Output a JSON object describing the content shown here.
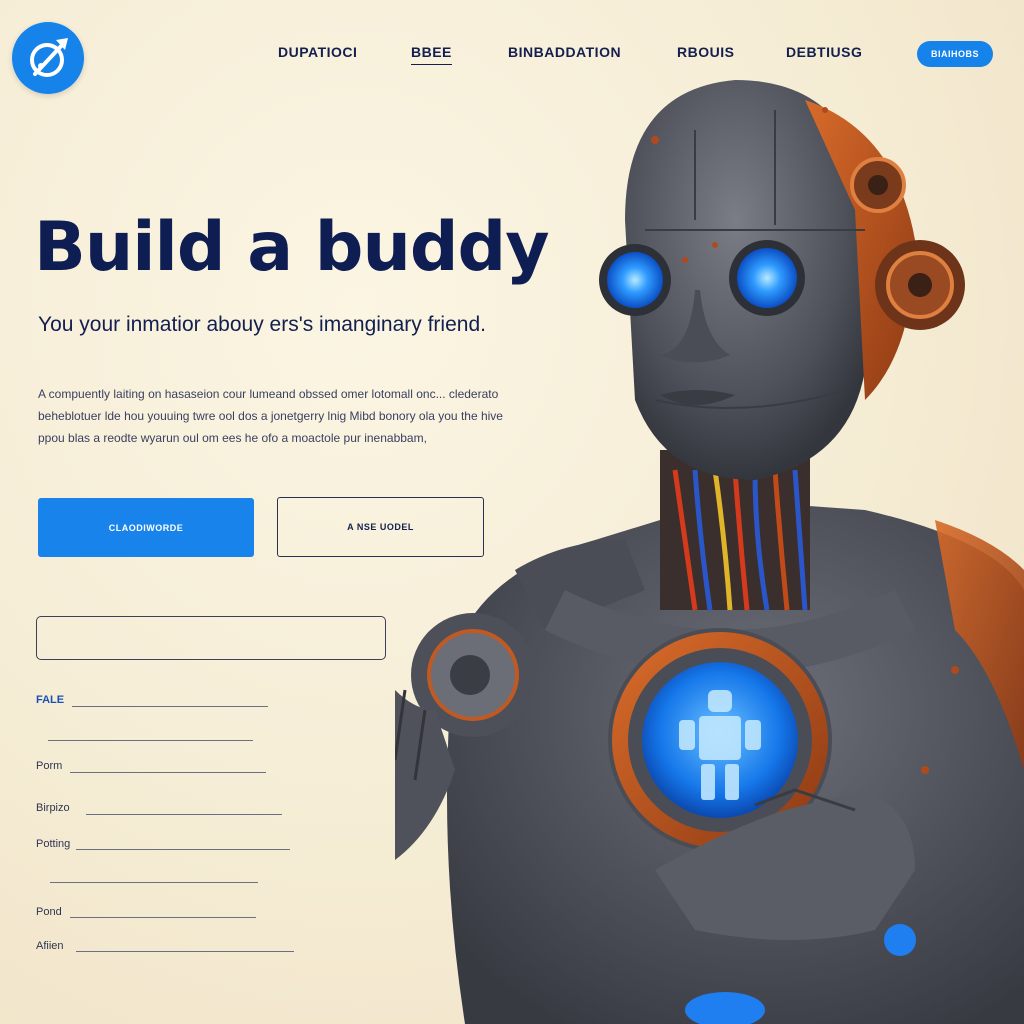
{
  "logo": {
    "icon": "compass-icon",
    "color": "#1583ea"
  },
  "nav": {
    "items": [
      {
        "label": "DUPATIOCI",
        "active": false
      },
      {
        "label": "BBEE",
        "active": true
      },
      {
        "label": "BINBADDATION",
        "active": false
      },
      {
        "label": "RBOUIS",
        "active": false
      },
      {
        "label": "DEBTIUSG",
        "active": false
      }
    ],
    "cta_label": "BIAIHOBS"
  },
  "hero": {
    "title": "Build  a buddy",
    "subtitle": "You your inmatior abouy ers's imanginary friend.",
    "body": "A  compuently laiting on hasaseion cour lumeand obssed omer lotomall onc... clederato beheblotuer lde hou youuing twre ool dos a jonetgerry lnig Mibd bonory ola you the hive ppou blas a reodte wyarun oul om ees he ofo a moactole pur inenabbam,"
  },
  "buttons": {
    "primary_label": "CLAODIWORDE",
    "secondary_label": "A NSE UODEL"
  },
  "form": {
    "name_placeholder": "",
    "fields": [
      {
        "label": "FALE",
        "highlight": true
      },
      {
        "label": "",
        "highlight": false
      },
      {
        "label": "Porm",
        "highlight": false
      },
      {
        "label": "Birpizo",
        "highlight": false
      },
      {
        "label": "Potting",
        "highlight": false
      },
      {
        "label": "",
        "highlight": false
      },
      {
        "label": "Pond",
        "highlight": false
      },
      {
        "label": "Afiien",
        "highlight": false
      }
    ]
  },
  "colors": {
    "accent": "#1583ea",
    "navy": "#0f1e52",
    "background": "#f5ecd4"
  },
  "illustration": {
    "icon": "robot-illustration"
  }
}
